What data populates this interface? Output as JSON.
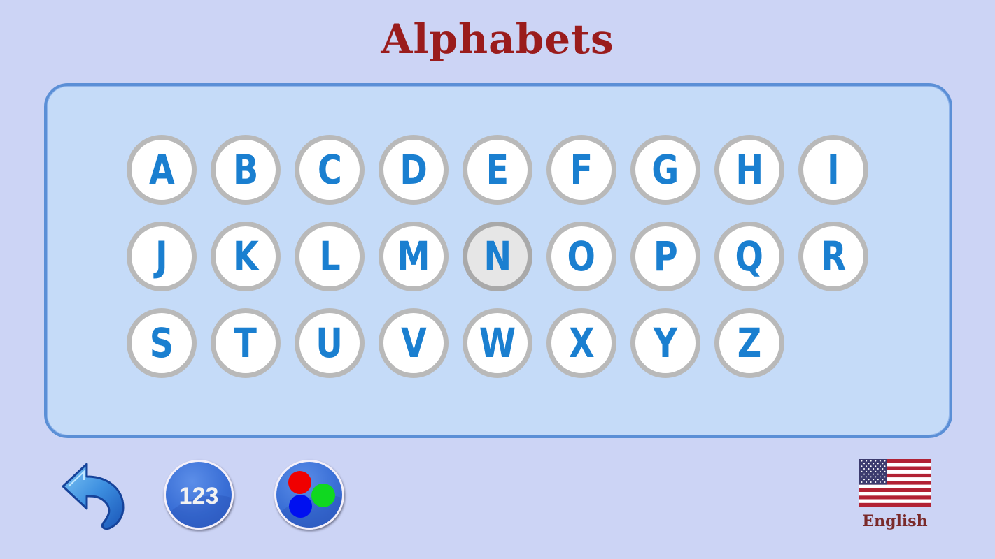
{
  "header": {
    "title": "Alphabets"
  },
  "letters": {
    "items": [
      "A",
      "B",
      "C",
      "D",
      "E",
      "F",
      "G",
      "H",
      "I",
      "J",
      "K",
      "L",
      "M",
      "N",
      "O",
      "P",
      "Q",
      "R",
      "S",
      "T",
      "U",
      "V",
      "W",
      "X",
      "Y",
      "Z"
    ],
    "selected": "N"
  },
  "toolbar": {
    "back_icon": "back-arrow-icon",
    "numbers_label": "123",
    "colors_icon": "color-dots-icon",
    "colors": {
      "red": "#f00000",
      "green": "#10d820",
      "blue": "#0010f0"
    }
  },
  "language": {
    "label": "English",
    "flag": "us-flag-icon"
  },
  "theme": {
    "title_color": "#9a1c1c",
    "letter_color": "#1a7fd0",
    "board_color": "#c5dbf8",
    "background": "#ccd4f5"
  }
}
